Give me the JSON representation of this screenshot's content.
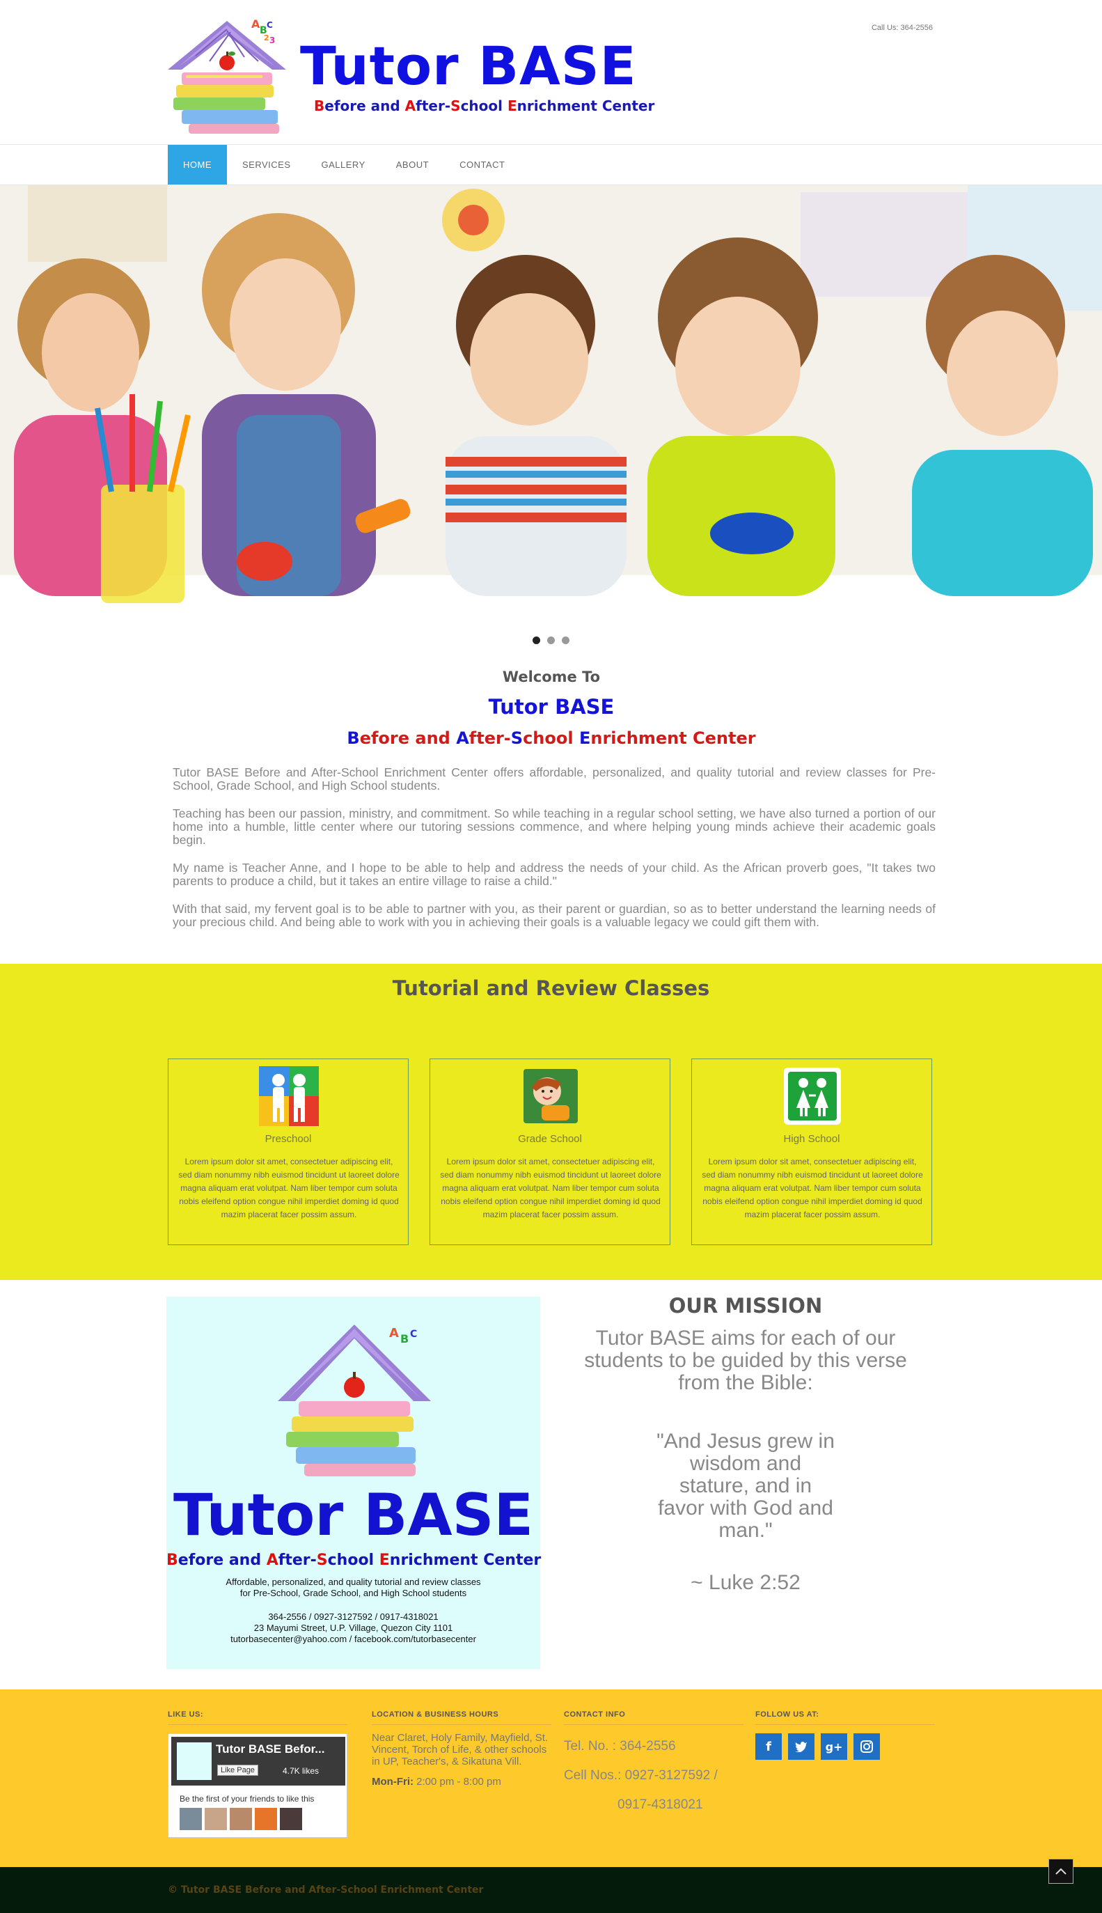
{
  "header": {
    "logo_title": "Tutor BASE",
    "logo_sub_parts": [
      "B",
      "efore and ",
      "A",
      "fter-",
      "S",
      "chool ",
      "E",
      "nrichment Center"
    ],
    "call": "Call Us: 364-2556"
  },
  "nav": {
    "items": [
      "HOME",
      "SERVICES",
      "GALLERY",
      "ABOUT",
      "CONTACT"
    ],
    "active": "HOME"
  },
  "welcome": {
    "pre": "Welcome To",
    "title": "Tutor BASE",
    "sub_parts": [
      "B",
      "efore and ",
      "A",
      "fter-",
      "S",
      "chool ",
      "E",
      "nrichment Center"
    ],
    "p1": "Tutor BASE Before and After-School Enrichment Center offers affordable, personalized, and quality tutorial and review classes for Pre-School, Grade School, and High School students.",
    "p2": "Teaching has been our passion, ministry, and commitment. So while teaching in a regular school setting, we have also turned a portion of our home into a humble, little center where our tutoring sessions commence, and where helping young minds achieve their academic goals begin.",
    "p3": "My name is Teacher Anne, and I hope to be able to help and address the needs of your child. As the African proverb goes, \"It takes two parents to produce a child, but it takes an entire village to raise a child.\"",
    "p4": "With that said, my fervent goal is to be able to partner with you, as their parent or guardian, so as to better understand the learning needs of your precious child. And being able to work with you in achieving their goals is a valuable legacy we could gift them with."
  },
  "classes": {
    "title": "Tutorial and Review Classes",
    "cards": [
      {
        "name": "Preschool",
        "body": "Lorem ipsum dolor sit amet, consectetuer adipiscing elit, sed diam nonummy nibh euismod tincidunt ut laoreet dolore magna aliquam erat volutpat. Nam liber tempor cum soluta nobis eleifend option congue nihil imperdiet doming id quod mazim placerat facer possim assum."
      },
      {
        "name": "Grade School",
        "body": "Lorem ipsum dolor sit amet, consectetuer adipiscing elit, sed diam nonummy nibh euismod tincidunt ut laoreet dolore magna aliquam erat volutpat. Nam liber tempor cum soluta nobis eleifend option congue nihil imperdiet doming id quod mazim placerat facer possim assum."
      },
      {
        "name": "High School",
        "body": "Lorem ipsum dolor sit amet, consectetuer adipiscing elit, sed diam nonummy nibh euismod tincidunt ut laoreet dolore magna aliquam erat volutpat. Nam liber tempor cum soluta nobis eleifend option congue nihil imperdiet doming id quod mazim placerat facer possim assum."
      }
    ]
  },
  "mission_image": {
    "title": "Tutor BASE",
    "sub_parts": [
      "B",
      "efore and ",
      "A",
      "fter-",
      "S",
      "chool ",
      "E",
      "nrichment Center"
    ],
    "line1": "Affordable, personalized, and quality tutorial and review classes",
    "line2": "for Pre-School, Grade School, and High School students",
    "line3": "364-2556 / 0927-3127592 / 0917-4318021",
    "line4": "23 Mayumi Street, U.P. Village, Quezon City 1101",
    "line5": "tutorbasecenter@yahoo.com / facebook.com/tutorbasecenter"
  },
  "mission": {
    "title": "OUR MISSION",
    "intro": "Tutor BASE aims for each of our students to be guided by this verse from the Bible:",
    "verse": "\"And Jesus grew in wisdom and stature, and in favor with God and man.\"",
    "ref": "~ Luke 2:52"
  },
  "footer": {
    "like_head": "LIKE US:",
    "fb_name": "Tutor BASE Befor...",
    "fb_like": "Like Page",
    "fb_count": "4.7K likes",
    "fb_first": "Be the first of your friends to like this",
    "loc_head": "LOCATION & BUSINESS HOURS",
    "loc_text": "Near Claret, Holy Family, Mayfield, St. Vincent, Torch of Life, & other schools in UP, Teacher's, & Sikatuna Vill.",
    "hours_label": "Mon-Fri:",
    "hours_value": " 2:00 pm - 8:00 pm",
    "contact_head": "CONTACT INFO",
    "tel": "Tel. No. : 364-2556",
    "cell": "Cell Nos.: 0927-3127592 /",
    "cell2": "0917-4318021",
    "follow_head": "FOLLOW US AT:",
    "social": [
      "f",
      "t",
      "g+",
      "ig"
    ],
    "copyright": "© Tutor BASE Before and After-School Enrichment Center"
  },
  "colors": {
    "accent": "#2ea6e6",
    "logo_blue": "#1414d8",
    "logo_red": "#d31a1a",
    "classes_bg": "#ebea1f",
    "footer_bg": "#fec92a",
    "bottom_bg": "#041b0c",
    "social_bg": "#1f6fc4"
  },
  "hero": {
    "slides": 3,
    "active_slide": 1
  }
}
